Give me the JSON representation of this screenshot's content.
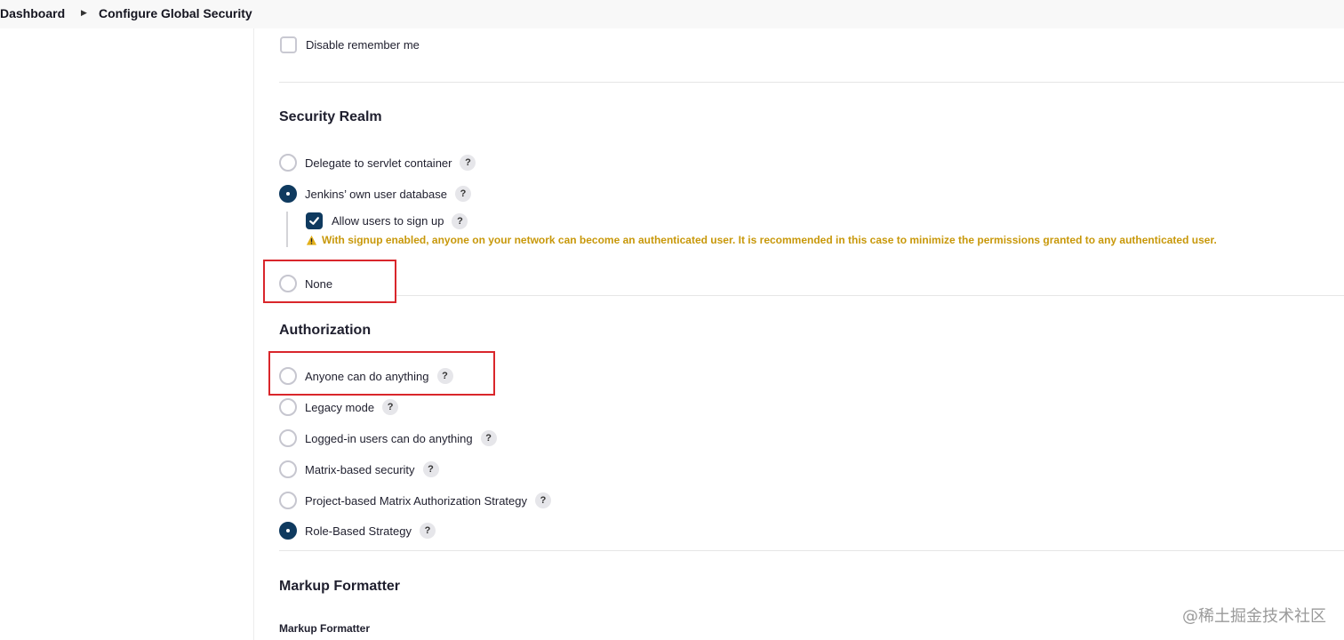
{
  "breadcrumb": {
    "items": [
      "Dashboard",
      "Configure Global Security"
    ],
    "separator": "›"
  },
  "remember_me": {
    "label": "Disable remember me",
    "checked": false
  },
  "security_realm": {
    "title": "Security Realm",
    "options": [
      {
        "label": "Delegate to servlet container",
        "selected": false,
        "help": "?"
      },
      {
        "label": "Jenkins’ own user database",
        "selected": true,
        "help": "?"
      },
      {
        "label": "None",
        "selected": false
      }
    ],
    "allow_signup": {
      "label": "Allow users to sign up",
      "checked": true,
      "help": "?"
    },
    "warning": "With signup enabled, anyone on your network can become an authenticated user. It is recommended in this case to minimize the permissions granted to any authenticated user."
  },
  "authorization": {
    "title": "Authorization",
    "options": [
      {
        "label": "Anyone can do anything",
        "selected": false,
        "help": "?"
      },
      {
        "label": "Legacy mode",
        "selected": false,
        "help": "?"
      },
      {
        "label": "Logged-in users can do anything",
        "selected": false,
        "help": "?"
      },
      {
        "label": "Matrix-based security",
        "selected": false,
        "help": "?"
      },
      {
        "label": "Project-based Matrix Authorization Strategy",
        "selected": false,
        "help": "?"
      },
      {
        "label": "Role-Based Strategy",
        "selected": true,
        "help": "?"
      }
    ]
  },
  "markup_formatter": {
    "title": "Markup Formatter",
    "field_label": "Markup Formatter"
  },
  "watermark": "@稀土掘金技术社区",
  "colors": {
    "accent": "#0f3a5f",
    "warning": "#c8980a",
    "highlight": "#d9262b"
  }
}
